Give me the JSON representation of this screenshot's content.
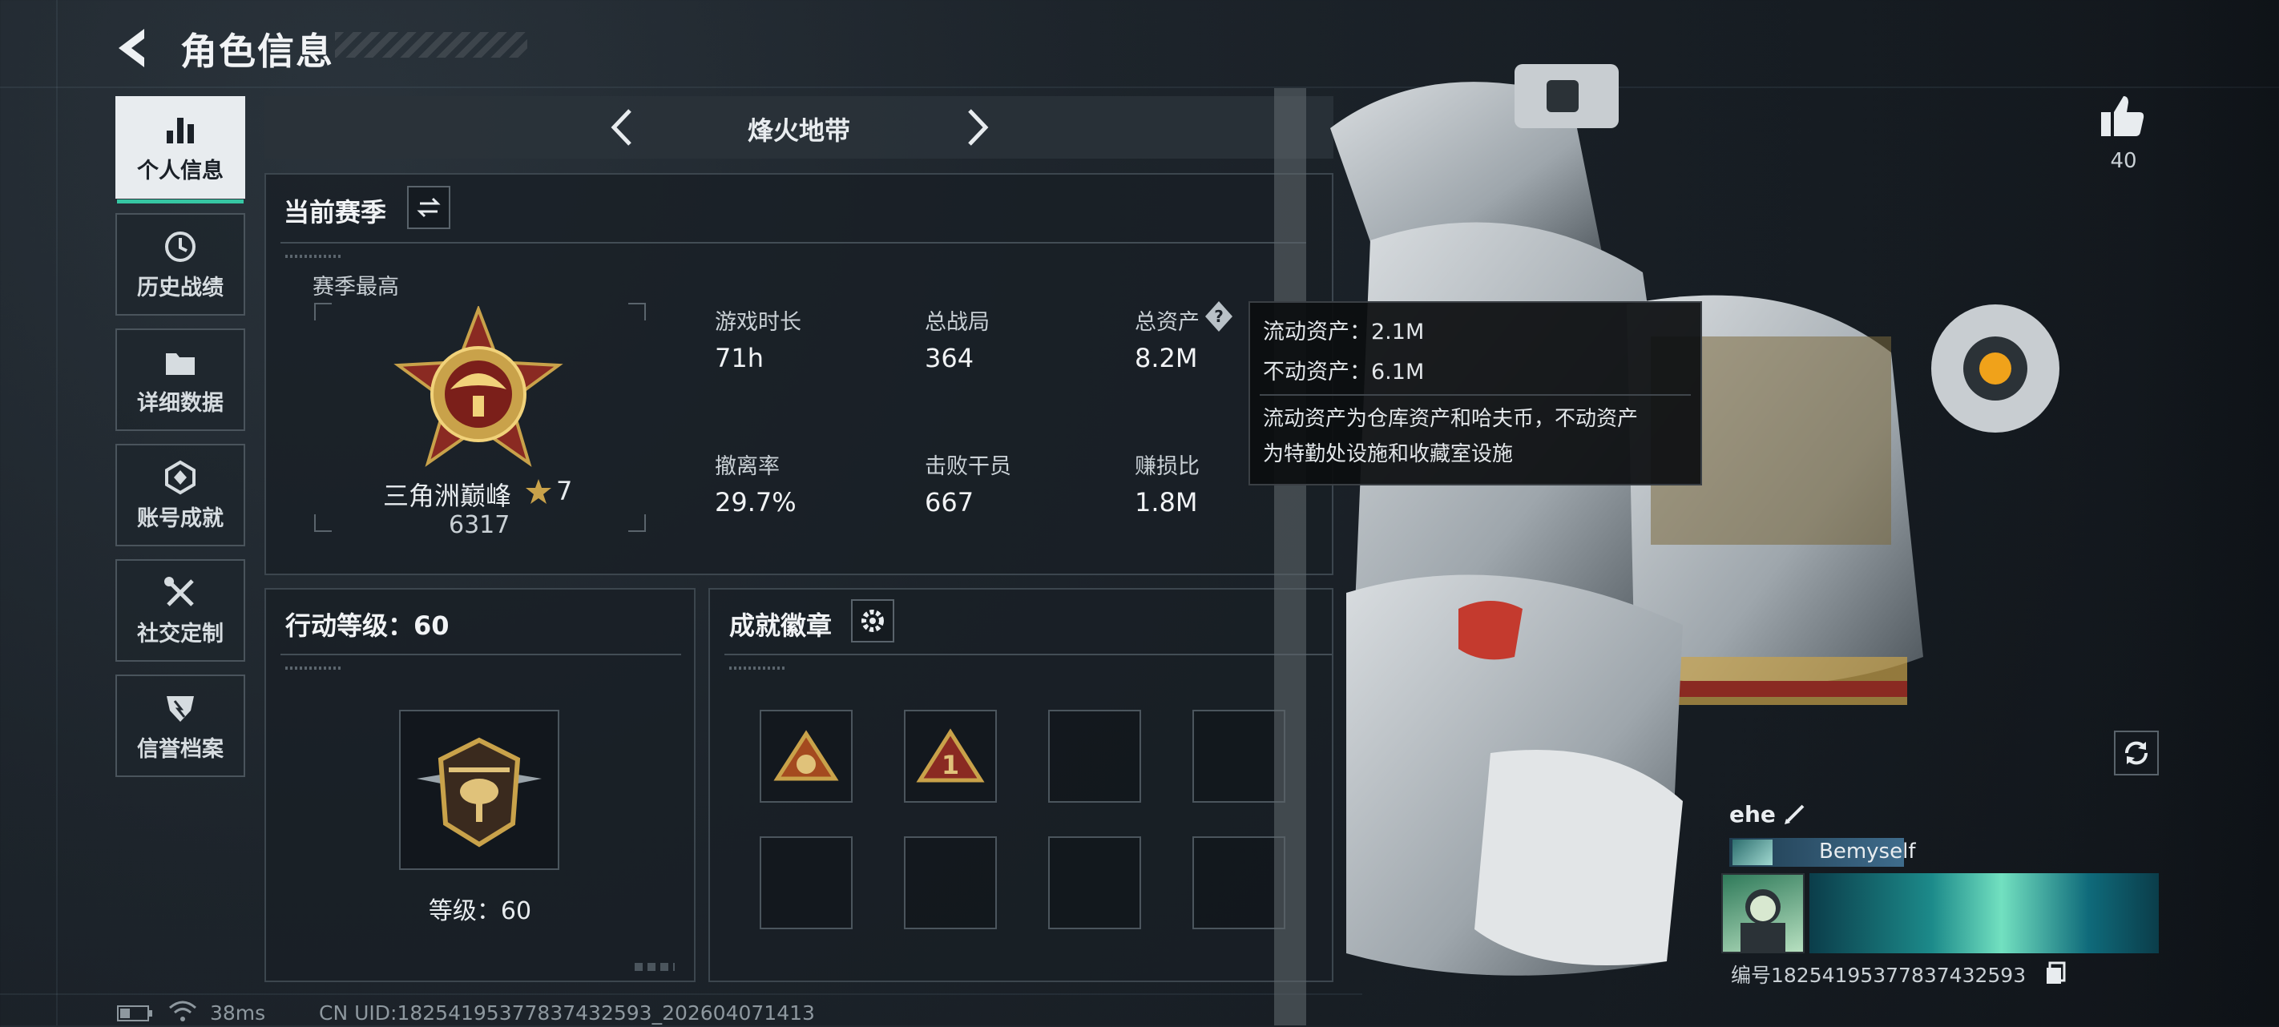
{
  "header": {
    "title": "角色信息",
    "back_icon": "back-arrow-icon"
  },
  "sidebar": {
    "items": [
      {
        "label": "个人信息",
        "icon": "bar-chart-icon",
        "active": true
      },
      {
        "label": "历史战绩",
        "icon": "clock-history-icon",
        "active": false
      },
      {
        "label": "详细数据",
        "icon": "folder-icon",
        "active": false
      },
      {
        "label": "账号成就",
        "icon": "achievement-icon",
        "active": false
      },
      {
        "label": "社交定制",
        "icon": "wrench-screwdriver-icon",
        "active": false
      },
      {
        "label": "信誉档案",
        "icon": "shield-badge-icon",
        "active": false
      }
    ]
  },
  "map_selector": {
    "name": "烽火地带",
    "prev_icon": "chevron-left-icon",
    "next_icon": "chevron-right-icon"
  },
  "season": {
    "title": "当前赛季",
    "swap_icon": "swap-icon",
    "best_label": "赛季最高",
    "rank_name": "三角洲巅峰",
    "rank_star_icon": "star-icon",
    "rank_stars": "7",
    "rank_score": "6317",
    "stats": [
      {
        "label": "游戏时长",
        "value": "71h"
      },
      {
        "label": "总战局",
        "value": "364"
      },
      {
        "label": "总资产",
        "value": "8.2M"
      },
      {
        "label": "撤离率",
        "value": "29.7%"
      },
      {
        "label": "击败干员",
        "value": "667"
      },
      {
        "label": "赚损比",
        "value": "1.8M"
      }
    ],
    "help_icon": "question-mark-icon"
  },
  "tooltip": {
    "liquid": "流动资产：2.1M",
    "fixed": "不动资产：6.1M",
    "desc_line1": "流动资产为仓库资产和哈夫币，不动资产",
    "desc_line2": "为特勤处设施和收藏室设施"
  },
  "level": {
    "title": "行动等级：60",
    "level_text": "等级：60"
  },
  "badges": {
    "title": "成就徽章",
    "settings_icon": "gear-icon"
  },
  "right": {
    "likes": "40",
    "like_icon": "thumbs-up-icon",
    "refresh_icon": "refresh-icon",
    "player_name": "ehe",
    "edit_icon": "pencil-icon",
    "tag": "Bemyself",
    "player_id": "编号1825419537783743259​3",
    "copy_icon": "copy-icon"
  },
  "status_bar": {
    "ping": "38ms",
    "uid": "CN UID:18254195377837432593_202604071413",
    "battery_icon": "battery-icon",
    "wifi_icon": "wifi-icon"
  },
  "colors": {
    "accent": "#36c6a3",
    "gold": "#c9a24a",
    "tag_bg": "#3f6c8c"
  }
}
